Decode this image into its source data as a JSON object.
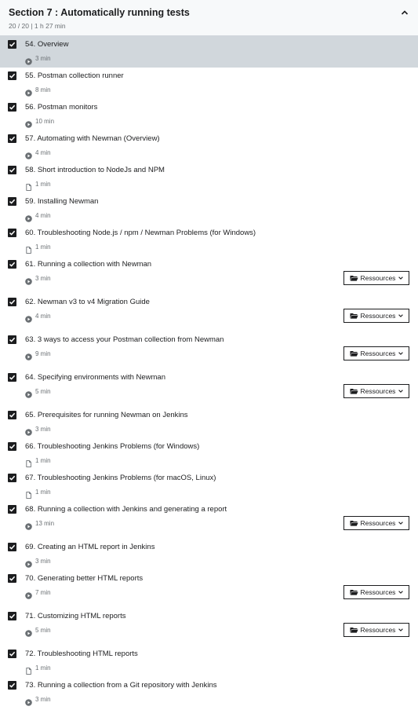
{
  "section": {
    "title": "Section 7 : Automatically running tests",
    "meta": "20 / 20 | 1 h 27 min"
  },
  "resources_label": "Ressources",
  "items": [
    {
      "label": "54. Overview",
      "duration": "3 min",
      "type": "video",
      "resources": false,
      "active": true
    },
    {
      "label": "55. Postman collection runner",
      "duration": "8 min",
      "type": "video",
      "resources": false
    },
    {
      "label": "56. Postman monitors",
      "duration": "10 min",
      "type": "video",
      "resources": false
    },
    {
      "label": "57. Automating with Newman (Overview)",
      "duration": "4 min",
      "type": "video",
      "resources": false
    },
    {
      "label": "58. Short introduction to NodeJs and NPM",
      "duration": "1 min",
      "type": "article",
      "resources": false
    },
    {
      "label": "59. Installing Newman",
      "duration": "4 min",
      "type": "video",
      "resources": false
    },
    {
      "label": "60. Troubleshooting Node.js / npm / Newman Problems (for Windows)",
      "duration": "1 min",
      "type": "article",
      "resources": false
    },
    {
      "label": "61. Running a collection with Newman",
      "duration": "3 min",
      "type": "video",
      "resources": true
    },
    {
      "label": "62. Newman v3 to v4 Migration Guide",
      "duration": "4 min",
      "type": "video",
      "resources": true
    },
    {
      "label": "63. 3 ways to access your Postman collection from Newman",
      "duration": "9 min",
      "type": "video",
      "resources": true
    },
    {
      "label": "64. Specifying environments with Newman",
      "duration": "5 min",
      "type": "video",
      "resources": true
    },
    {
      "label": "65. Prerequisites for running Newman on Jenkins",
      "duration": "3 min",
      "type": "video",
      "resources": false
    },
    {
      "label": "66. Troubleshooting Jenkins Problems (for Windows)",
      "duration": "1 min",
      "type": "article",
      "resources": false
    },
    {
      "label": "67. Troubleshooting Jenkins Problems (for macOS, Linux)",
      "duration": "1 min",
      "type": "article",
      "resources": false
    },
    {
      "label": "68. Running a collection with Jenkins and generating a report",
      "duration": "13 min",
      "type": "video",
      "resources": true
    },
    {
      "label": "69. Creating an HTML report in Jenkins",
      "duration": "3 min",
      "type": "video",
      "resources": false
    },
    {
      "label": "70. Generating better HTML reports",
      "duration": "7 min",
      "type": "video",
      "resources": true
    },
    {
      "label": "71. Customizing HTML reports",
      "duration": "5 min",
      "type": "video",
      "resources": true
    },
    {
      "label": "72. Troubleshooting HTML reports",
      "duration": "1 min",
      "type": "article",
      "resources": false
    },
    {
      "label": "73. Running a collection from a Git repository with Jenkins",
      "duration": "3 min",
      "type": "video",
      "resources": false
    }
  ]
}
